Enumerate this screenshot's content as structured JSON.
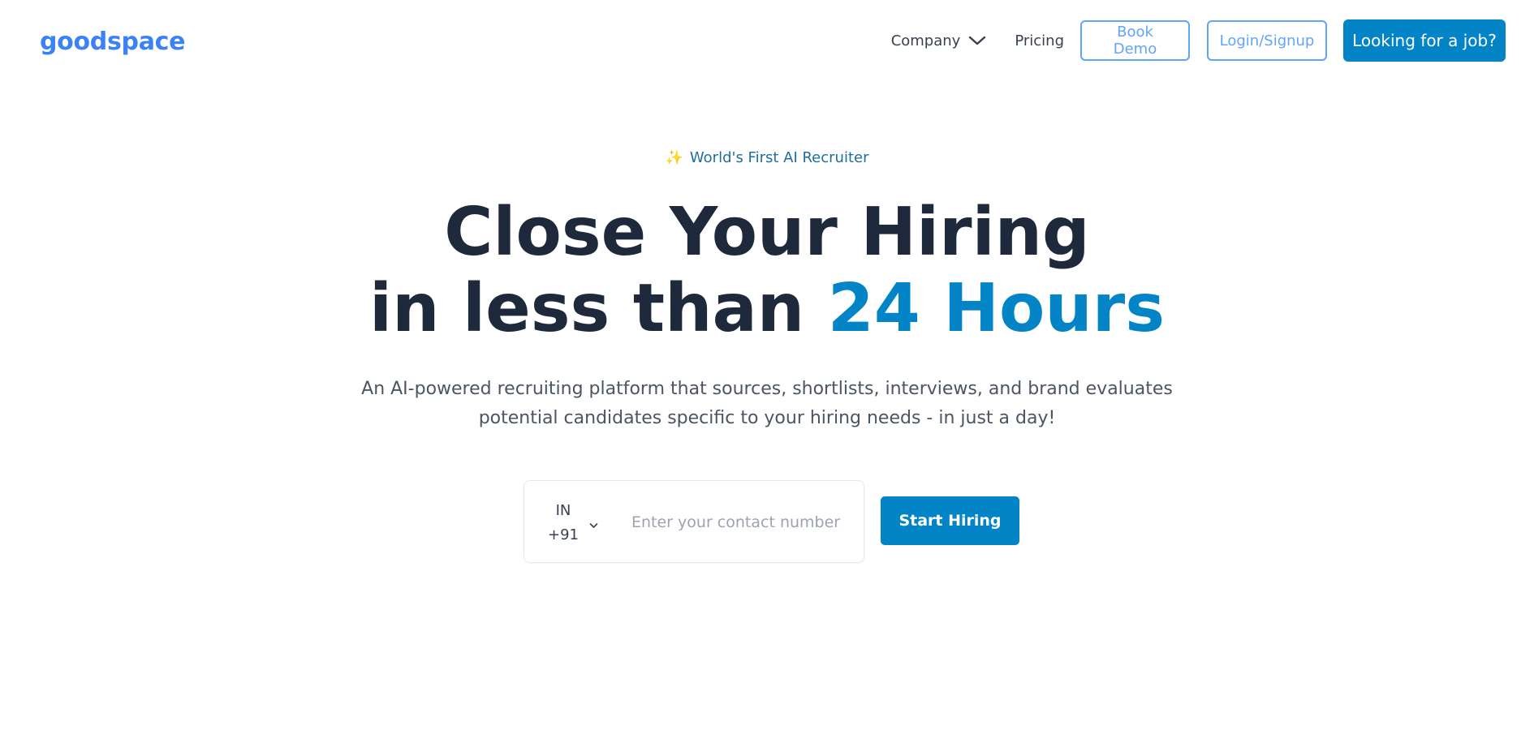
{
  "brand": {
    "logo_text": "goodspace",
    "accent_color": "#3b82f6",
    "primary_color": "#0284c7"
  },
  "nav": {
    "company_label": "Company",
    "pricing_label": "Pricing",
    "book_demo_label": "Book Demo",
    "login_label": "Login/Signup",
    "job_label": "Looking for a job?"
  },
  "hero": {
    "badge_icon": "sparkles-icon",
    "badge_emoji": "✨",
    "badge_text": "World's First AI Recruiter",
    "headline_line1": "Close Your Hiring",
    "headline_line2_prefix": "in less than",
    "headline_line2_accent": "24 Hours",
    "subtext": "An AI-powered recruiting platform that sources, shortlists, interviews, and brand evaluates potential candidates specific to your hiring needs - in just a day!"
  },
  "form": {
    "country_code": "IN",
    "dial_code": "+91",
    "phone_value": "",
    "phone_placeholder": "Enter your contact number",
    "submit_label": "Start Hiring"
  }
}
